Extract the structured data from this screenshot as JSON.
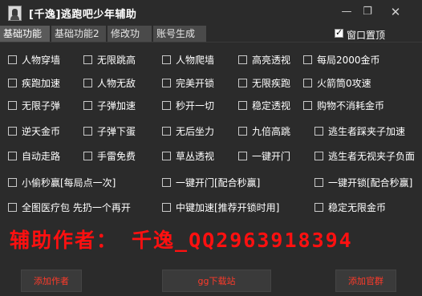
{
  "window": {
    "title": "[千逸]逃跑吧少年辅助",
    "controls": {
      "minimize": "—",
      "maximize": "❐",
      "close": "✕"
    }
  },
  "tabs": [
    {
      "label": "基础功能",
      "active": true
    },
    {
      "label": "基础功能2",
      "active": false
    },
    {
      "label": "修改功能",
      "active": false
    },
    {
      "label": "账号生成器",
      "active": false
    }
  ],
  "topmost": {
    "label": "窗口置顶",
    "checked": true
  },
  "options": [
    {
      "label": "人物穿墙",
      "checked": false
    },
    {
      "label": "无限跳高",
      "checked": false
    },
    {
      "label": "人物爬墙",
      "checked": false
    },
    {
      "label": "高亮透视",
      "checked": false
    },
    {
      "label": "每局2000金币",
      "checked": false
    },
    {
      "label": "疾跑加速",
      "checked": false
    },
    {
      "label": "人物无敌",
      "checked": false
    },
    {
      "label": "完美开锁",
      "checked": false
    },
    {
      "label": "无限疾跑",
      "checked": false
    },
    {
      "label": "火箭筒0攻速",
      "checked": false
    },
    {
      "label": "无限子弹",
      "checked": false
    },
    {
      "label": "子弹加速",
      "checked": false
    },
    {
      "label": "秒开一切",
      "checked": false
    },
    {
      "label": "稳定透视",
      "checked": false
    },
    {
      "label": "购物不消耗金币",
      "checked": false
    },
    {
      "label": "逆天金币",
      "checked": false
    },
    {
      "label": "子弹下蛋",
      "checked": false
    },
    {
      "label": "无后坐力",
      "checked": false
    },
    {
      "label": "九倍高跳",
      "checked": false
    },
    {
      "label": "逃生者踩夹子加速",
      "checked": false
    },
    {
      "label": "自动走路",
      "checked": false
    },
    {
      "label": "手雷免费",
      "checked": false
    },
    {
      "label": "草丛透视",
      "checked": false
    },
    {
      "label": "一键开门",
      "checked": false
    },
    {
      "label": "逃生者无视夹子负面",
      "checked": false
    },
    {
      "label": "小偷秒赢[每局点一次]",
      "checked": false
    },
    {
      "label": "一键开门[配合秒赢]",
      "checked": false
    },
    {
      "label": "一键开锁[配合秒赢]",
      "checked": false
    },
    {
      "label": "全图医疗包 先扔一个再开",
      "checked": false
    },
    {
      "label": "中键加速[推荐开锁时用]",
      "checked": false
    },
    {
      "label": "稳定无限金币",
      "checked": false
    }
  ],
  "author_text": "辅助作者： 千逸_QQ2963918394",
  "buttons": {
    "add_author": "添加作者",
    "gg_download": "gg下载站",
    "add_group": "添加官群"
  },
  "colors": {
    "background": "#2b2b2b",
    "author_red": "#ff1010",
    "button_text": "#ff3a2a"
  }
}
